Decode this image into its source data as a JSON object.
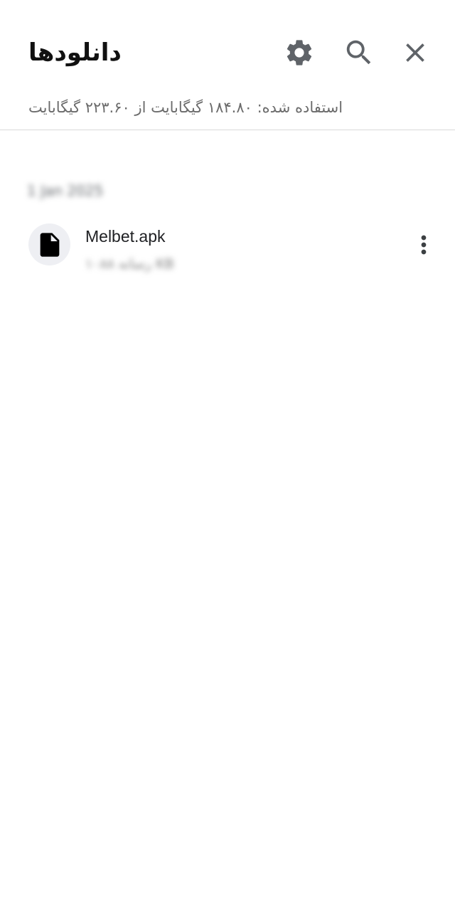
{
  "header": {
    "title": "دانلودها",
    "settings_icon": "gear-icon",
    "search_icon": "search-icon",
    "close_icon": "close-icon"
  },
  "storage": {
    "text": "استفاده شده: ۱۸۴.۸۰ گیگابایت از ۲۲۳.۶۰ گیگابایت"
  },
  "groups": [
    {
      "date": "1 Jan 2025",
      "items": [
        {
          "name": "Melbet.apk",
          "meta": "رسانه ۱۰۸۸ KB",
          "icon": "file-icon",
          "menu_icon": "more-vert-icon"
        }
      ]
    }
  ],
  "colors": {
    "icon_gray": "#5f6368",
    "title_text": "#111111",
    "secondary_text": "#6b6b6b",
    "divider": "#dadada",
    "file_circle_bg": "#eeeff3"
  }
}
